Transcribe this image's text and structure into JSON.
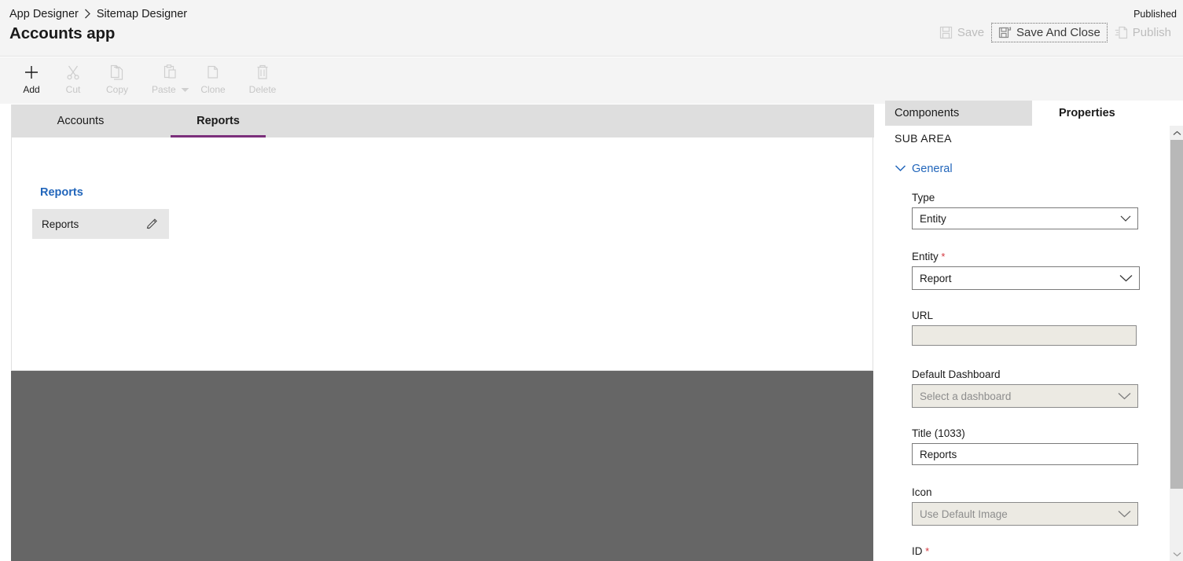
{
  "header": {
    "breadcrumb": {
      "parent": "App Designer",
      "separator": "›",
      "current": "Sitemap Designer"
    },
    "app_title": "Accounts app",
    "published_status": "Published",
    "commands": [
      {
        "label": "Save",
        "icon": "save-icon",
        "enabled": false,
        "focused": false
      },
      {
        "label": "Save And Close",
        "icon": "save-and-close-icon",
        "enabled": false,
        "focused": true
      },
      {
        "label": "Publish",
        "icon": "publish-icon",
        "enabled": false,
        "focused": false
      }
    ]
  },
  "toolbar": {
    "items": [
      {
        "label": "Add",
        "icon": "plus-icon",
        "enabled": true,
        "has_caret": false
      },
      {
        "label": "Cut",
        "icon": "scissors-icon",
        "enabled": false,
        "has_caret": false
      },
      {
        "label": "Copy",
        "icon": "copy-icon",
        "enabled": false,
        "has_caret": false
      },
      {
        "label": "Paste",
        "icon": "clipboard-icon",
        "enabled": false,
        "has_caret": true
      },
      {
        "label": "Clone",
        "icon": "clone-icon",
        "enabled": false,
        "has_caret": false
      },
      {
        "label": "Delete",
        "icon": "trash-icon",
        "enabled": false,
        "has_caret": false
      }
    ]
  },
  "canvas": {
    "tabs": [
      {
        "label": "Accounts",
        "active": false
      },
      {
        "label": "Reports",
        "active": true
      }
    ],
    "group_title": "Reports",
    "subarea": {
      "label": "Reports",
      "edit_icon": "pencil-icon",
      "selected": true
    }
  },
  "panel": {
    "tabs": [
      {
        "label": "Components",
        "active": false
      },
      {
        "label": "Properties",
        "active": true
      }
    ],
    "section_heading": "SUB AREA",
    "group": {
      "label": "General",
      "expanded": true,
      "chevron_icon": "chevron-down-icon"
    },
    "fields": [
      {
        "label": "Type",
        "required": false,
        "control": "dropdown",
        "value": "Entity",
        "placeholder": "",
        "disabled": false,
        "icon": "chevron-down-icon"
      },
      {
        "label": "Entity",
        "required": true,
        "control": "dropdown",
        "value": "Report",
        "placeholder": "",
        "disabled": false,
        "icon": "chevron-down-icon"
      },
      {
        "label": "URL",
        "required": false,
        "control": "text",
        "value": "",
        "placeholder": "",
        "disabled": true,
        "icon": ""
      },
      {
        "label": "Default Dashboard",
        "required": false,
        "control": "dropdown",
        "value": "",
        "placeholder": "Select a dashboard",
        "disabled": true,
        "icon": "chevron-down-icon"
      },
      {
        "label": "Title (1033)",
        "required": false,
        "control": "text",
        "value": "Reports",
        "placeholder": "",
        "disabled": false,
        "icon": ""
      },
      {
        "label": "Icon",
        "required": false,
        "control": "dropdown",
        "value": "",
        "placeholder": "Use Default Image",
        "disabled": true,
        "icon": "chevron-down-icon"
      },
      {
        "label": "ID",
        "required": true,
        "control": "text",
        "value": "",
        "placeholder": "",
        "disabled": true,
        "icon": ""
      }
    ],
    "scrollbar": {
      "up_icon": "scroll-up-icon",
      "down_icon": "scroll-down-icon"
    }
  },
  "colors": {
    "accent_tab": "#7b2f7b",
    "link_blue": "#2266bb",
    "required_red": "#d4373f",
    "header_bg": "#f4f4f4",
    "tab_bg": "#dedede",
    "overlay_gray": "#666666",
    "disabled_field": "#eceae3"
  }
}
